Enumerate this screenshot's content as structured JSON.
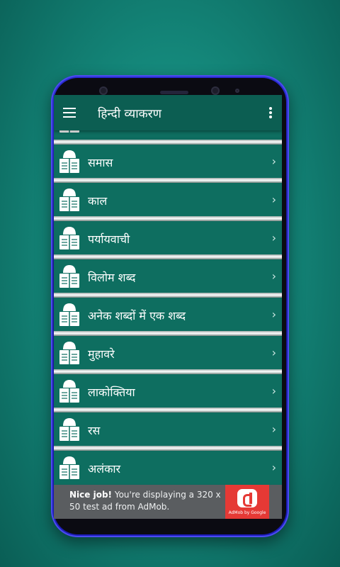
{
  "app": {
    "title": "हिन्दी व्याकरण",
    "accent": "#0c5e52",
    "background": "#0d6b5e"
  },
  "list": {
    "items": [
      {
        "label": "समास"
      },
      {
        "label": "काल"
      },
      {
        "label": "पर्यायवाची"
      },
      {
        "label": "विलोम शब्द"
      },
      {
        "label": "अनेक शब्दों में एक शब्द"
      },
      {
        "label": "मुहावरे"
      },
      {
        "label": "लाकोक्तिया"
      },
      {
        "label": "रस"
      },
      {
        "label": "अलंकार"
      }
    ],
    "chevron": "›"
  },
  "ad": {
    "bold": "Nice job!",
    "text": " You're displaying a 320 x 50 test ad from AdMob.",
    "brand": "AdMob by Google"
  },
  "icons": {
    "menu": "hamburger-menu-icon",
    "more": "more-vert-icon",
    "item": "person-reading-icon",
    "chevron": "chevron-right-icon"
  }
}
